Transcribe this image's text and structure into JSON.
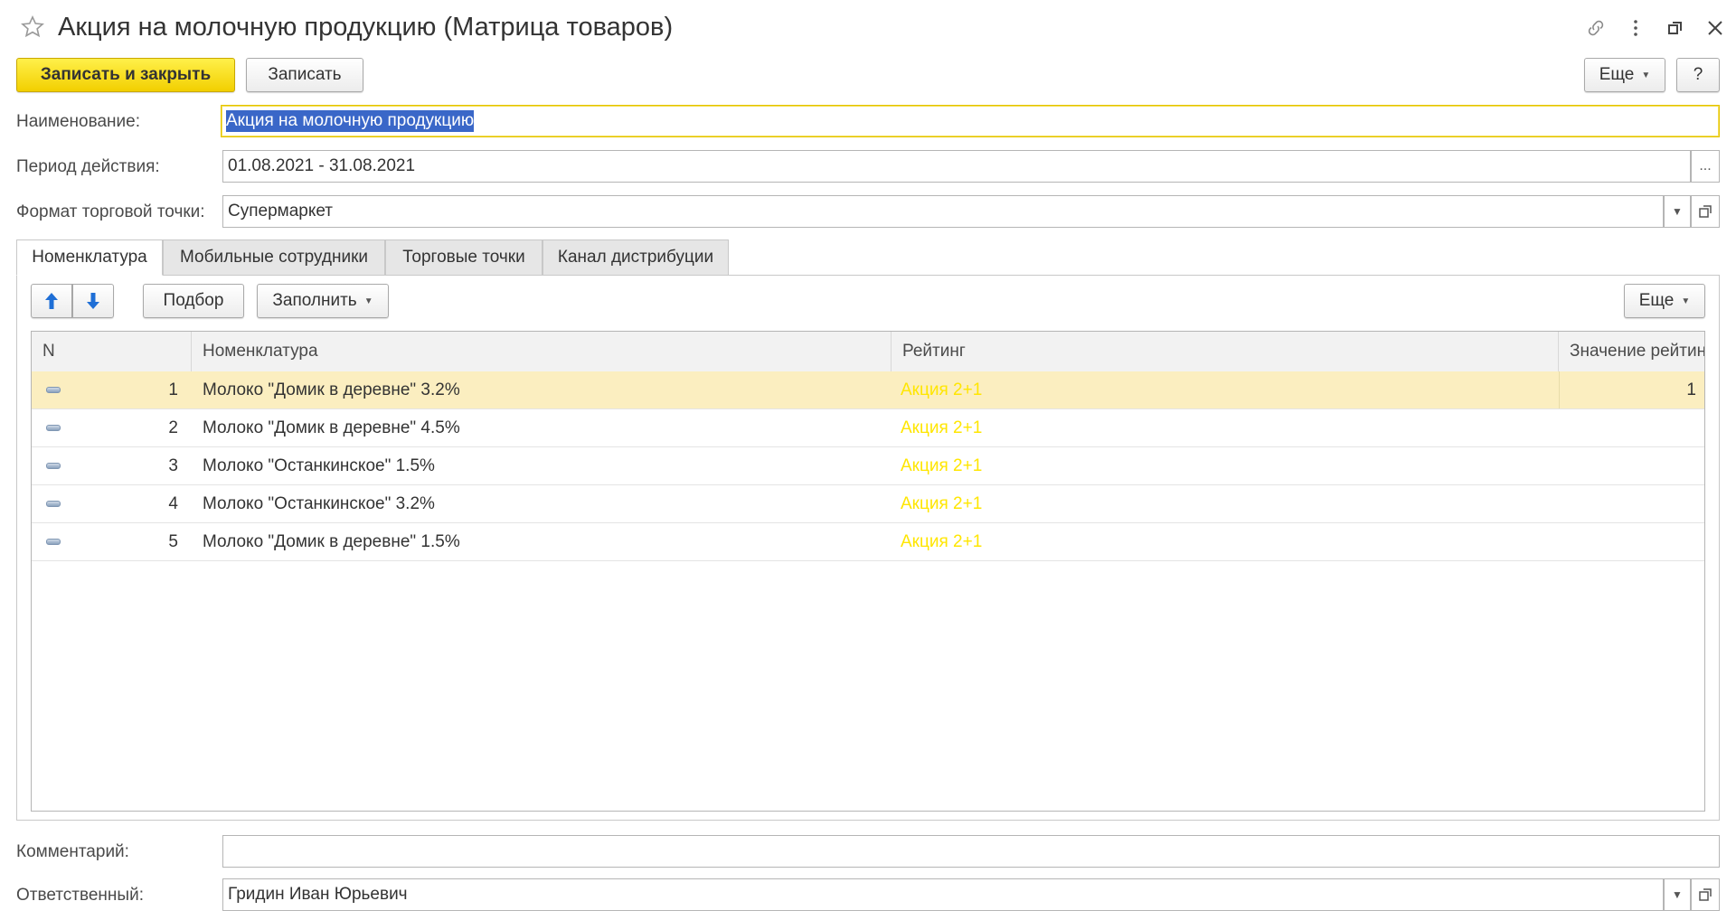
{
  "window": {
    "title": "Акция на молочную продукцию (Матрица товаров)"
  },
  "toolbar": {
    "save_close_label": "Записать и закрыть",
    "save_label": "Записать",
    "more_label": "Еще",
    "help_label": "?"
  },
  "form": {
    "name_label": "Наименование:",
    "name_value": "Акция на молочную продукцию",
    "period_label": "Период действия:",
    "period_value": "01.08.2021 - 31.08.2021",
    "period_button": "...",
    "format_label": "Формат торговой точки:",
    "format_value": "Супермаркет",
    "comment_label": "Комментарий:",
    "comment_value": "",
    "responsible_label": "Ответственный:",
    "responsible_value": "Гридин Иван Юрьевич"
  },
  "tabs": [
    {
      "label": "Номенклатура"
    },
    {
      "label": "Мобильные сотрудники"
    },
    {
      "label": "Торговые точки"
    },
    {
      "label": "Канал дистрибуции"
    }
  ],
  "table_toolbar": {
    "pick_label": "Подбор",
    "fill_label": "Заполнить",
    "more_label": "Еще"
  },
  "table": {
    "columns": [
      "N",
      "Номенклатура",
      "Рейтинг",
      "Значение рейтинга"
    ],
    "rows": [
      {
        "n": "1",
        "item": "Молоко \"Домик в деревне\" 3.2%",
        "rating": "Акция 2+1",
        "rating_value": "1"
      },
      {
        "n": "2",
        "item": "Молоко \"Домик в деревне\" 4.5%",
        "rating": "Акция 2+1",
        "rating_value": ""
      },
      {
        "n": "3",
        "item": "Молоко \"Останкинское\" 1.5%",
        "rating": "Акция 2+1",
        "rating_value": ""
      },
      {
        "n": "4",
        "item": "Молоко \"Останкинское\" 3.2%",
        "rating": "Акция 2+1",
        "rating_value": ""
      },
      {
        "n": "5",
        "item": "Молоко \"Домик в деревне\" 1.5%",
        "rating": "Акция 2+1",
        "rating_value": ""
      }
    ]
  },
  "colors": {
    "primary_button": "#f5d800",
    "rating_text": "#ffe600",
    "selected_row": "#fbeec0",
    "arrow_blue": "#1f6fd6"
  }
}
